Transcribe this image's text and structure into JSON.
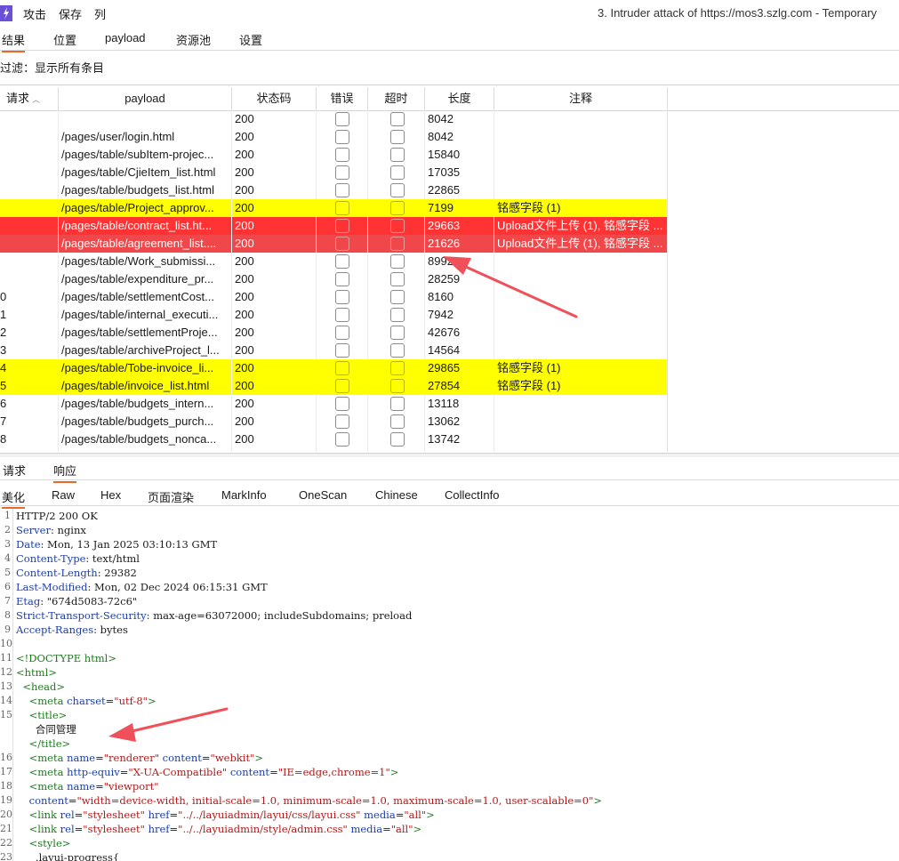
{
  "menu": {
    "attack": "攻击",
    "save": "保存",
    "columns": "列"
  },
  "window_title": "3. Intruder attack of https://mos3.szlg.com - Temporary",
  "main_tabs": [
    "结果",
    "位置",
    "payload",
    "资源池",
    "设置"
  ],
  "filter_text": "过滤：显示所有条目",
  "table": {
    "headers": [
      "请求",
      "payload",
      "状态码",
      "错误",
      "超时",
      "长度",
      "注释"
    ],
    "rows": [
      {
        "req": "",
        "payload": "",
        "status": "200",
        "length": "8042",
        "comment": "",
        "hl": ""
      },
      {
        "req": "",
        "payload": "/pages/user/login.html",
        "status": "200",
        "length": "8042",
        "comment": "",
        "hl": ""
      },
      {
        "req": "",
        "payload": "/pages/table/subItem-projec...",
        "status": "200",
        "length": "15840",
        "comment": "",
        "hl": ""
      },
      {
        "req": "",
        "payload": "/pages/table/CjieItem_list.html",
        "status": "200",
        "length": "17035",
        "comment": "",
        "hl": ""
      },
      {
        "req": "",
        "payload": "/pages/table/budgets_list.html",
        "status": "200",
        "length": "22865",
        "comment": "",
        "hl": ""
      },
      {
        "req": "",
        "payload": "/pages/table/Project_approv...",
        "status": "200",
        "length": "7199",
        "comment": "铭感字段 (1)",
        "hl": "yellow"
      },
      {
        "req": "",
        "payload": "/pages/table/contract_list.ht...",
        "status": "200",
        "length": "29663",
        "comment": "Upload文件上传 (1), 铭感字段 ...",
        "hl": "red"
      },
      {
        "req": "",
        "payload": "/pages/table/agreement_list....",
        "status": "200",
        "length": "21626",
        "comment": "Upload文件上传 (1), 铭感字段 ...",
        "hl": "red2"
      },
      {
        "req": "",
        "payload": "/pages/table/Work_submissi...",
        "status": "200",
        "length": "8992",
        "comment": "",
        "hl": ""
      },
      {
        "req": "",
        "payload": "/pages/table/expenditure_pr...",
        "status": "200",
        "length": "28259",
        "comment": "",
        "hl": ""
      },
      {
        "req": "0",
        "payload": "/pages/table/settlementCost...",
        "status": "200",
        "length": "8160",
        "comment": "",
        "hl": ""
      },
      {
        "req": "1",
        "payload": "/pages/table/internal_executi...",
        "status": "200",
        "length": "7942",
        "comment": "",
        "hl": ""
      },
      {
        "req": "2",
        "payload": "/pages/table/settlementProje...",
        "status": "200",
        "length": "42676",
        "comment": "",
        "hl": ""
      },
      {
        "req": "3",
        "payload": "/pages/table/archiveProject_l...",
        "status": "200",
        "length": "14564",
        "comment": "",
        "hl": ""
      },
      {
        "req": "4",
        "payload": "/pages/table/Tobe-invoice_li...",
        "status": "200",
        "length": "29865",
        "comment": "铭感字段 (1)",
        "hl": "yellow"
      },
      {
        "req": "5",
        "payload": "/pages/table/invoice_list.html",
        "status": "200",
        "length": "27854",
        "comment": "铭感字段 (1)",
        "hl": "yellow"
      },
      {
        "req": "6",
        "payload": "/pages/table/budgets_intern...",
        "status": "200",
        "length": "13118",
        "comment": "",
        "hl": ""
      },
      {
        "req": "7",
        "payload": "/pages/table/budgets_purch...",
        "status": "200",
        "length": "13062",
        "comment": "",
        "hl": ""
      },
      {
        "req": "8",
        "payload": "/pages/table/budgets_nonca...",
        "status": "200",
        "length": "13742",
        "comment": "",
        "hl": ""
      }
    ]
  },
  "rr_tabs": [
    "请求",
    "响应"
  ],
  "sub_tabs": [
    "美化",
    "Raw",
    "Hex",
    "页面渲染",
    "MarkInfo",
    "OneScan",
    "Chinese",
    "CollectInfo"
  ],
  "response_lines": [
    {
      "n": "1",
      "parts": [
        [
          "t",
          "HTTP/2 200 OK"
        ]
      ]
    },
    {
      "n": "2",
      "parts": [
        [
          "k",
          "Server"
        ],
        [
          "t",
          ": nginx"
        ]
      ]
    },
    {
      "n": "3",
      "parts": [
        [
          "k",
          "Date"
        ],
        [
          "t",
          ": Mon, 13 Jan 2025 03:10:13 GMT"
        ]
      ]
    },
    {
      "n": "4",
      "parts": [
        [
          "k",
          "Content-Type"
        ],
        [
          "t",
          ": text/html"
        ]
      ]
    },
    {
      "n": "5",
      "parts": [
        [
          "k",
          "Content-Length"
        ],
        [
          "t",
          ": 29382"
        ]
      ]
    },
    {
      "n": "6",
      "parts": [
        [
          "k",
          "Last-Modified"
        ],
        [
          "t",
          ": Mon, 02 Dec 2024 06:15:31 GMT"
        ]
      ]
    },
    {
      "n": "7",
      "parts": [
        [
          "k",
          "Etag"
        ],
        [
          "t",
          ": \"674d5083-72c6\""
        ]
      ]
    },
    {
      "n": "8",
      "parts": [
        [
          "k",
          "Strict-Transport-Security"
        ],
        [
          "t",
          ": max-age=63072000; includeSubdomains; preload"
        ]
      ]
    },
    {
      "n": "9",
      "parts": [
        [
          "k",
          "Accept-Ranges"
        ],
        [
          "t",
          ": bytes"
        ]
      ]
    },
    {
      "n": "10",
      "parts": []
    },
    {
      "n": "11",
      "parts": [
        [
          "g",
          "<!DOCTYPE html>"
        ]
      ]
    },
    {
      "n": "12",
      "parts": [
        [
          "g",
          "<html>"
        ]
      ]
    },
    {
      "n": "13",
      "parts": [
        [
          "t",
          "  "
        ],
        [
          "g",
          "<head>"
        ]
      ]
    },
    {
      "n": "14",
      "parts": [
        [
          "t",
          "    "
        ],
        [
          "g",
          "<meta "
        ],
        [
          "a",
          "charset"
        ],
        [
          "t",
          "="
        ],
        [
          "v",
          "\"utf-8\""
        ],
        [
          "g",
          ">"
        ]
      ]
    },
    {
      "n": "15",
      "parts": [
        [
          "t",
          "    "
        ],
        [
          "g",
          "<title>"
        ]
      ]
    },
    {
      "n": "",
      "parts": [
        [
          "t",
          "      合同管理"
        ]
      ]
    },
    {
      "n": "",
      "parts": [
        [
          "t",
          "    "
        ],
        [
          "g",
          "</title>"
        ]
      ]
    },
    {
      "n": "16",
      "parts": [
        [
          "t",
          "    "
        ],
        [
          "g",
          "<meta "
        ],
        [
          "a",
          "name"
        ],
        [
          "t",
          "="
        ],
        [
          "v",
          "\"renderer\""
        ],
        [
          "t",
          " "
        ],
        [
          "a",
          "content"
        ],
        [
          "t",
          "="
        ],
        [
          "v",
          "\"webkit\""
        ],
        [
          "g",
          ">"
        ]
      ]
    },
    {
      "n": "17",
      "parts": [
        [
          "t",
          "    "
        ],
        [
          "g",
          "<meta "
        ],
        [
          "a",
          "http-equiv"
        ],
        [
          "t",
          "="
        ],
        [
          "v",
          "\"X-UA-Compatible\""
        ],
        [
          "t",
          " "
        ],
        [
          "a",
          "content"
        ],
        [
          "t",
          "="
        ],
        [
          "v",
          "\"IE=edge,chrome=1\""
        ],
        [
          "g",
          ">"
        ]
      ]
    },
    {
      "n": "18",
      "parts": [
        [
          "t",
          "    "
        ],
        [
          "g",
          "<meta "
        ],
        [
          "a",
          "name"
        ],
        [
          "t",
          "="
        ],
        [
          "v",
          "\"viewport\""
        ]
      ]
    },
    {
      "n": "19",
      "parts": [
        [
          "t",
          "    "
        ],
        [
          "a",
          "content"
        ],
        [
          "t",
          "="
        ],
        [
          "v",
          "\"width=device-width, initial-scale=1.0, minimum-scale=1.0, maximum-scale=1.0, user-scalable=0\""
        ],
        [
          "g",
          ">"
        ]
      ]
    },
    {
      "n": "20",
      "parts": [
        [
          "t",
          "    "
        ],
        [
          "g",
          "<link "
        ],
        [
          "a",
          "rel"
        ],
        [
          "t",
          "="
        ],
        [
          "v",
          "\"stylesheet\""
        ],
        [
          "t",
          " "
        ],
        [
          "a",
          "href"
        ],
        [
          "t",
          "="
        ],
        [
          "v",
          "\"../../layuiadmin/layui/css/layui.css\""
        ],
        [
          "t",
          " "
        ],
        [
          "a",
          "media"
        ],
        [
          "t",
          "="
        ],
        [
          "v",
          "\"all\""
        ],
        [
          "g",
          ">"
        ]
      ]
    },
    {
      "n": "21",
      "parts": [
        [
          "t",
          "    "
        ],
        [
          "g",
          "<link "
        ],
        [
          "a",
          "rel"
        ],
        [
          "t",
          "="
        ],
        [
          "v",
          "\"stylesheet\""
        ],
        [
          "t",
          " "
        ],
        [
          "a",
          "href"
        ],
        [
          "t",
          "="
        ],
        [
          "v",
          "\"../../layuiadmin/style/admin.css\""
        ],
        [
          "t",
          " "
        ],
        [
          "a",
          "media"
        ],
        [
          "t",
          "="
        ],
        [
          "v",
          "\"all\""
        ],
        [
          "g",
          ">"
        ]
      ]
    },
    {
      "n": "22",
      "parts": [
        [
          "t",
          "    "
        ],
        [
          "g",
          "<style>"
        ]
      ]
    },
    {
      "n": "23",
      "parts": [
        [
          "t",
          "      .layui-progress{"
        ]
      ]
    }
  ],
  "colors": {
    "accent": "#e8692a",
    "yellow": "#ffff00",
    "red": "#ff3333",
    "red2": "#f0484a",
    "arrow": "#f0505a"
  }
}
